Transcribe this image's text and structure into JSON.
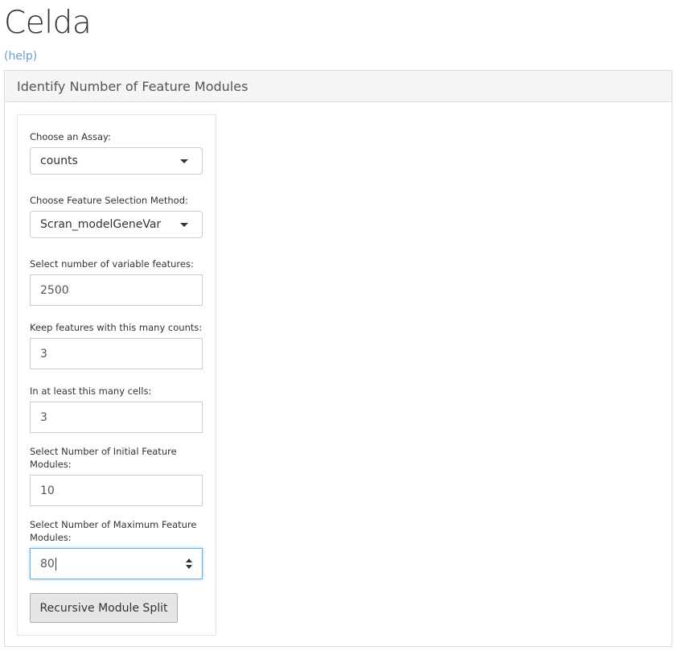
{
  "app": {
    "title": "Celda",
    "help_link": "(help)"
  },
  "panel": {
    "heading": "Identify Number of Feature Modules"
  },
  "form": {
    "assay": {
      "label": "Choose an Assay:",
      "value": "counts"
    },
    "feature_selection": {
      "label": "Choose Feature Selection Method:",
      "value": "Scran_modelGeneVar"
    },
    "variable_features": {
      "label": "Select number of variable features:",
      "value": "2500"
    },
    "min_counts": {
      "label": "Keep features with this many counts:",
      "value": "3"
    },
    "min_cells": {
      "label": "In at least this many cells:",
      "value": "3"
    },
    "initial_modules": {
      "label": "Select Number of Initial Feature Modules:",
      "value": "10"
    },
    "max_modules": {
      "label": "Select Number of Maximum Feature Modules:",
      "value": "80"
    },
    "submit_label": "Recursive Module Split"
  },
  "icons": {
    "dropdown": "caret-down-icon",
    "spinner": "number-spinner-icon"
  },
  "colors": {
    "link": "#6a9fcf",
    "focus_border": "#66afe9",
    "button_bg": "#e6e6e6",
    "panel_heading_bg": "#f5f5f5"
  }
}
